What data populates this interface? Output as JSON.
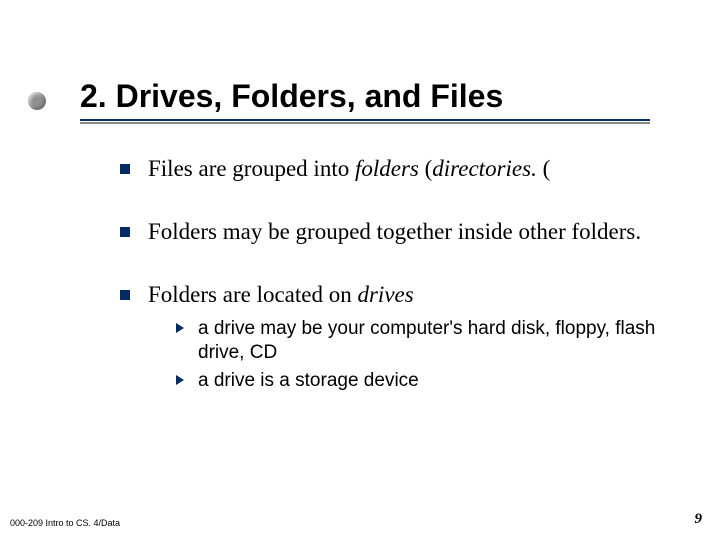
{
  "title": "2.  Drives, Folders, and Files",
  "bullets": [
    {
      "runs": [
        {
          "t": "Files are grouped into ",
          "i": false
        },
        {
          "t": "folders",
          "i": true
        },
        {
          "t": " (",
          "i": false
        },
        {
          "t": "directories.",
          "i": true
        },
        {
          "t": " (",
          "i": false
        }
      ]
    },
    {
      "runs": [
        {
          "t": "Folders may be grouped together inside other folders.",
          "i": false
        }
      ]
    },
    {
      "runs": [
        {
          "t": "Folders are located on ",
          "i": false
        },
        {
          "t": "drives",
          "i": true
        }
      ],
      "sub": [
        "a drive may be your computer's hard disk, floppy, flash drive, CD",
        "a drive is a storage device"
      ]
    }
  ],
  "footer": {
    "left": "000-209 Intro to CS. 4/Data",
    "right": "9"
  }
}
